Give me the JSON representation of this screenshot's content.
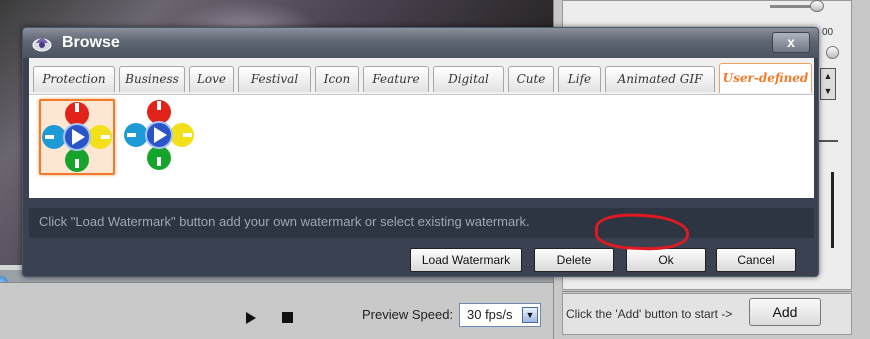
{
  "dialog": {
    "title": "Browse",
    "close_label": "x",
    "tabs": [
      {
        "label": "Protection"
      },
      {
        "label": "Business"
      },
      {
        "label": "Love"
      },
      {
        "label": "Festival"
      },
      {
        "label": "Icon"
      },
      {
        "label": "Feature"
      },
      {
        "label": "Digital"
      },
      {
        "label": "Cute"
      },
      {
        "label": "Life"
      },
      {
        "label": "Animated GIF"
      },
      {
        "label": "User-defined"
      }
    ],
    "active_tab": "User-defined",
    "watermarks": [
      {
        "icon": "colorful-cross-watermark-icon",
        "selected": true
      },
      {
        "icon": "colorful-cross-watermark-icon",
        "selected": false
      }
    ],
    "hint": "Click \"Load Watermark\" button add your own watermark or select existing watermark.",
    "buttons": {
      "load": "Load Watermark",
      "delete": "Delete",
      "ok": "Ok",
      "cancel": "Cancel"
    },
    "accent_color": "#f07b2a"
  },
  "background_app": {
    "preview_speed_label": "Preview Speed:",
    "fps_value": "30 fps/s",
    "add_hint": "Click the 'Add' button to start ->",
    "add_label": "Add",
    "top_right_value": "00"
  }
}
